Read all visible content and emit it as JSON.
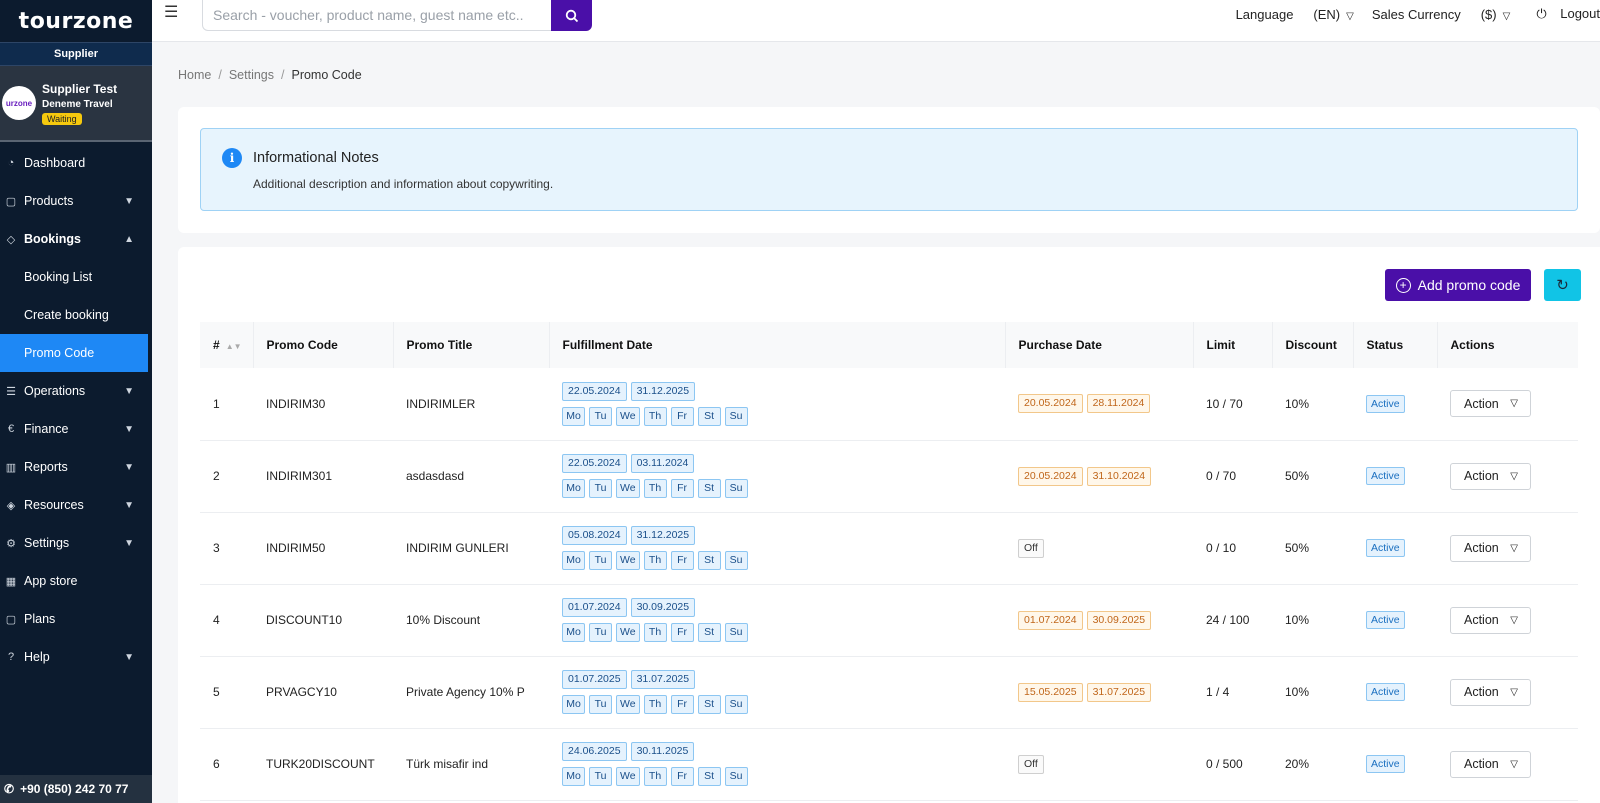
{
  "brand": {
    "logo_text": "tourzone",
    "role_label": "Supplier"
  },
  "profile": {
    "name": "Supplier Test",
    "company": "Deneme Travel",
    "status": "Waiting",
    "avatar_text": "urzone"
  },
  "sidebar": {
    "items": [
      {
        "label": "Dashboard",
        "icon": "gauge-icon"
      },
      {
        "label": "Products",
        "icon": "bag-icon"
      },
      {
        "label": "Bookings",
        "icon": "tag-icon"
      },
      {
        "label": "Operations",
        "icon": "list-icon"
      },
      {
        "label": "Finance",
        "icon": "euro-icon"
      },
      {
        "label": "Reports",
        "icon": "chart-icon"
      },
      {
        "label": "Resources",
        "icon": "box-icon"
      },
      {
        "label": "Settings",
        "icon": "gear-icon"
      },
      {
        "label": "App store",
        "icon": "apps-icon"
      },
      {
        "label": "Plans",
        "icon": "bag-icon"
      },
      {
        "label": "Help",
        "icon": "help-icon"
      }
    ],
    "bookings_sub": [
      "Booking List",
      "Create booking",
      "Promo Code"
    ],
    "phone": "+90 (850) 242 70 77"
  },
  "topbar": {
    "search_placeholder": "Search - voucher, product name, guest name etc..",
    "language_label": "Language",
    "language_value": "(EN)",
    "currency_label": "Sales Currency",
    "currency_value": "($)",
    "logout": "Logout"
  },
  "breadcrumb": {
    "home": "Home",
    "settings": "Settings",
    "current": "Promo Code"
  },
  "info": {
    "title": "Informational Notes",
    "description": "Additional description and information about copywriting."
  },
  "toolbar": {
    "add_label": "Add promo code"
  },
  "table": {
    "headers": [
      "#",
      "Promo Code",
      "Promo Title",
      "Fulfillment Date",
      "Purchase Date",
      "Limit",
      "Discount",
      "Status",
      "Actions"
    ],
    "days": [
      "Mo",
      "Tu",
      "We",
      "Th",
      "Fr",
      "St",
      "Su"
    ],
    "action_label": "Action",
    "rows": [
      {
        "n": "1",
        "code": "INDIRIM30",
        "title": "INDIRIMLER",
        "ful_start": "22.05.2024",
        "ful_end": "31.12.2025",
        "pur_start": "20.05.2024",
        "pur_end": "28.11.2024",
        "off": "",
        "limit": "10 / 70",
        "discount": "10%",
        "status": "Active"
      },
      {
        "n": "2",
        "code": "INDIRIM301",
        "title": "asdasdasd",
        "ful_start": "22.05.2024",
        "ful_end": "03.11.2024",
        "pur_start": "20.05.2024",
        "pur_end": "31.10.2024",
        "off": "",
        "limit": "0 / 70",
        "discount": "50%",
        "status": "Active"
      },
      {
        "n": "3",
        "code": "INDIRIM50",
        "title": "INDIRIM GUNLERI",
        "ful_start": "05.08.2024",
        "ful_end": "31.12.2025",
        "pur_start": "",
        "pur_end": "",
        "off": "Off",
        "limit": "0 / 10",
        "discount": "50%",
        "status": "Active"
      },
      {
        "n": "4",
        "code": "DISCOUNT10",
        "title": "10% Discount",
        "ful_start": "01.07.2024",
        "ful_end": "30.09.2025",
        "pur_start": "01.07.2024",
        "pur_end": "30.09.2025",
        "off": "",
        "limit": "24 / 100",
        "discount": "10%",
        "status": "Active"
      },
      {
        "n": "5",
        "code": "PRVAGCY10",
        "title": "Private Agency 10% P",
        "ful_start": "01.07.2025",
        "ful_end": "31.07.2025",
        "pur_start": "15.05.2025",
        "pur_end": "31.07.2025",
        "off": "",
        "limit": "1 / 4",
        "discount": "10%",
        "status": "Active"
      },
      {
        "n": "6",
        "code": "TURK20DISCOUNT",
        "title": "Türk misafir ind",
        "ful_start": "24.06.2025",
        "ful_end": "30.11.2025",
        "pur_start": "",
        "pur_end": "",
        "off": "Off",
        "limit": "0 / 500",
        "discount": "20%",
        "status": "Active"
      }
    ]
  },
  "colors": {
    "sidebar_bg": "#0c1b2e",
    "accent_purple": "#4a0fa8",
    "active_blue": "#1e88f5",
    "refresh_cyan": "#11c4e6"
  }
}
